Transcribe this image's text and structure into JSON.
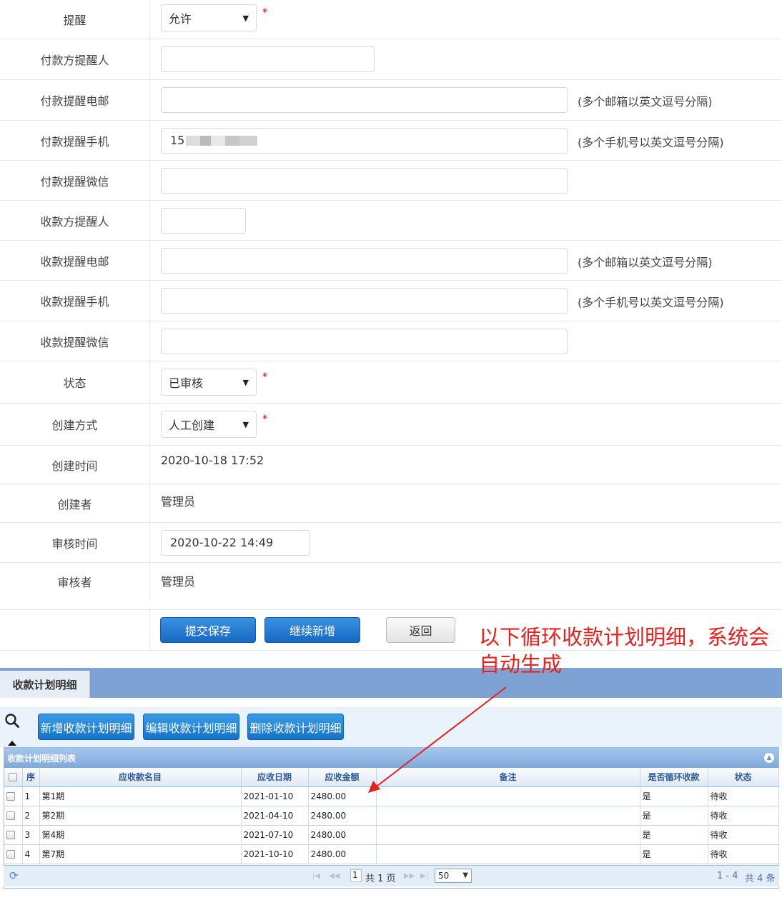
{
  "form": {
    "reminder": {
      "label": "提醒",
      "value": "允许"
    },
    "payer_reminder_person": {
      "label": "付款方提醒人",
      "value": ""
    },
    "payment_email": {
      "label": "付款提醒电邮",
      "value": "",
      "hint": "(多个邮箱以英文逗号分隔)"
    },
    "payment_mobile": {
      "label": "付款提醒手机",
      "value": "15",
      "hint": "(多个手机号以英文逗号分隔)"
    },
    "payment_wechat": {
      "label": "付款提醒微信",
      "value": ""
    },
    "payee_reminder_person": {
      "label": "收款方提醒人",
      "value": ""
    },
    "receipt_email": {
      "label": "收款提醒电邮",
      "value": "",
      "hint": "(多个邮箱以英文逗号分隔)"
    },
    "receipt_mobile": {
      "label": "收款提醒手机",
      "value": "",
      "hint": "(多个手机号以英文逗号分隔)"
    },
    "receipt_wechat": {
      "label": "收款提醒微信",
      "value": ""
    },
    "status": {
      "label": "状态",
      "value": "已审核"
    },
    "create_method": {
      "label": "创建方式",
      "value": "人工创建"
    },
    "create_time": {
      "label": "创建时间",
      "value": "2020-10-18 17:52"
    },
    "creator": {
      "label": "创建者",
      "value": "管理员"
    },
    "audit_time": {
      "label": "审核时间",
      "value": "2020-10-22 14:49"
    },
    "auditor": {
      "label": "审核者",
      "value": "管理员"
    },
    "required_mark": "*"
  },
  "actions": {
    "submit": "提交保存",
    "continue_add": "继续新增",
    "back": "返回"
  },
  "annotation": "以下循环收款计划明细，系统会自动生成",
  "section": {
    "tab": "收款计划明细"
  },
  "toolbar": {
    "add": "新增收款计划明细",
    "edit": "编辑收款计划明细",
    "delete": "删除收款计划明细"
  },
  "grid": {
    "title": "收款计划明细列表",
    "columns": [
      "序",
      "应收款名目",
      "应收日期",
      "应收金额",
      "备注",
      "是否循环收款",
      "状态"
    ],
    "rows": [
      {
        "no": "1",
        "name": "第1期",
        "date": "2021-01-10",
        "amount": "2480.00",
        "note": "",
        "recurring": "是",
        "status": "待收"
      },
      {
        "no": "2",
        "name": "第2期",
        "date": "2021-04-10",
        "amount": "2480.00",
        "note": "",
        "recurring": "是",
        "status": "待收"
      },
      {
        "no": "3",
        "name": "第4期",
        "date": "2021-07-10",
        "amount": "2480.00",
        "note": "",
        "recurring": "是",
        "status": "待收"
      },
      {
        "no": "4",
        "name": "第7期",
        "date": "2021-10-10",
        "amount": "2480.00",
        "note": "",
        "recurring": "是",
        "status": "待收"
      }
    ]
  },
  "pager": {
    "page": "1",
    "total_pages": "共 1 页",
    "page_size": "50",
    "range": "1 - 4",
    "total": "共 4 条"
  },
  "colors": {
    "accent": "#1668c4",
    "annotation": "#e8211c",
    "section_bar": "#7fa2d4"
  },
  "icons": [
    "search-icon",
    "collapse-up-icon",
    "refresh-icon",
    "first-page-icon",
    "prev-page-icon",
    "next-page-icon",
    "last-page-icon",
    "chevron-down-icon"
  ]
}
